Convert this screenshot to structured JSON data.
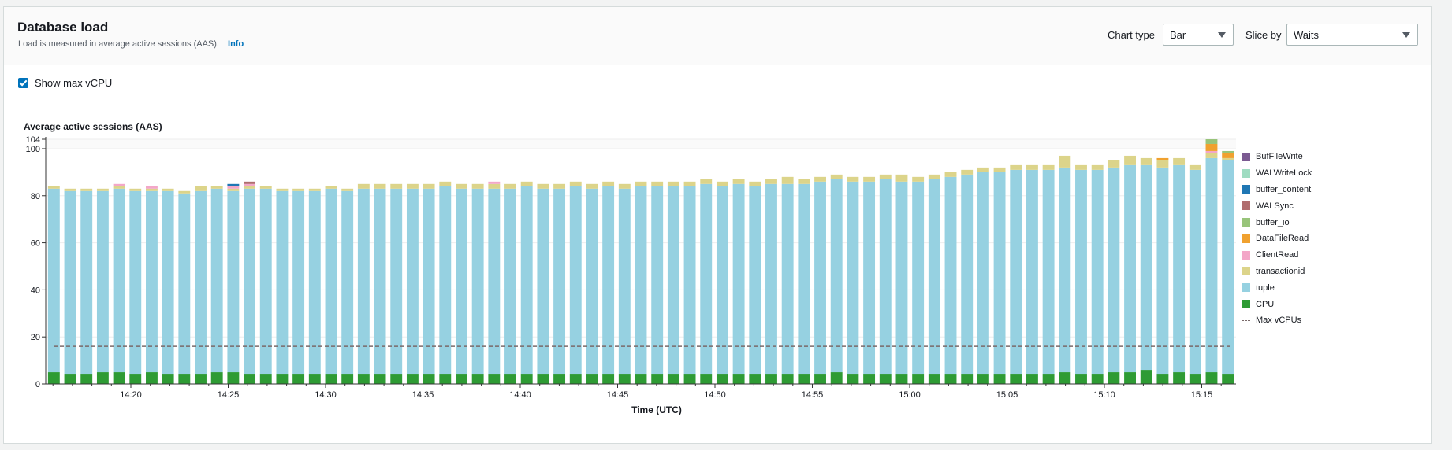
{
  "header": {
    "title": "Database load",
    "subtitle": "Load is measured in average active sessions (AAS).",
    "info_link": "Info",
    "chart_type_label": "Chart type",
    "chart_type_value": "Bar",
    "slice_by_label": "Slice by",
    "slice_by_value": "Waits"
  },
  "options": {
    "show_max_vcpu_label": "Show max vCPU",
    "show_max_vcpu_checked": true
  },
  "chart_data": {
    "type": "bar",
    "stacked": true,
    "title": "Average active sessions (AAS)",
    "xlabel": "Time (UTC)",
    "ylabel": "",
    "ylim": [
      0,
      104
    ],
    "yticks": [
      0,
      20,
      40,
      60,
      80,
      100,
      104
    ],
    "xticks": [
      "14:20",
      "14:25",
      "14:30",
      "14:35",
      "14:40",
      "14:45",
      "14:50",
      "14:55",
      "15:00",
      "15:05",
      "15:10",
      "15:15"
    ],
    "max_vcpus": 16,
    "legend_position": "right",
    "legend": [
      "BufFileWrite",
      "WALWriteLock",
      "buffer_content",
      "WALSync",
      "buffer_io",
      "DataFileRead",
      "ClientRead",
      "transactionid",
      "tuple",
      "CPU",
      "Max vCPUs"
    ],
    "colors": {
      "CPU": "#2e9b34",
      "tuple": "#96d1e1",
      "transactionid": "#dcd48a",
      "ClientRead": "#f3a7c8",
      "DataFileRead": "#f0a12f",
      "buffer_io": "#98c47a",
      "WALSync": "#b06d6e",
      "buffer_content": "#1f77b4",
      "WALWriteLock": "#9fdcc1",
      "BufFileWrite": "#7b5a91",
      "Max vCPUs": "#7a6a6a"
    },
    "series": [
      {
        "name": "CPU",
        "values": [
          5,
          4,
          4,
          5,
          5,
          4,
          5,
          4,
          4,
          4,
          5,
          5,
          4,
          4,
          4,
          4,
          4,
          4,
          4,
          4,
          4,
          4,
          4,
          4,
          4,
          4,
          4,
          4,
          4,
          4,
          4,
          4,
          4,
          4,
          4,
          4,
          4,
          4,
          4,
          4,
          4,
          4,
          4,
          4,
          4,
          4,
          4,
          4,
          5,
          4,
          4,
          4,
          4,
          4,
          4,
          4,
          4,
          4,
          4,
          4,
          4,
          4,
          5,
          4,
          4,
          5,
          5,
          6,
          4,
          5,
          4,
          5,
          4
        ]
      },
      {
        "name": "tuple",
        "values": [
          78,
          78,
          78,
          77,
          78,
          78,
          77,
          78,
          77,
          78,
          78,
          77,
          79,
          79,
          78,
          78,
          78,
          79,
          78,
          79,
          79,
          79,
          79,
          79,
          80,
          79,
          79,
          79,
          79,
          80,
          79,
          79,
          80,
          79,
          80,
          79,
          80,
          80,
          80,
          80,
          81,
          80,
          81,
          80,
          81,
          81,
          81,
          82,
          82,
          82,
          82,
          83,
          82,
          82,
          83,
          84,
          85,
          86,
          86,
          87,
          87,
          87,
          87,
          87,
          87,
          87,
          88,
          87,
          88,
          88,
          87,
          91,
          91
        ]
      },
      {
        "name": "transactionid",
        "values": [
          1,
          1,
          1,
          1,
          1,
          1,
          1,
          1,
          1,
          2,
          1,
          1,
          1,
          1,
          1,
          1,
          1,
          1,
          1,
          2,
          2,
          2,
          2,
          2,
          2,
          2,
          2,
          2,
          2,
          2,
          2,
          2,
          2,
          2,
          2,
          2,
          2,
          2,
          2,
          2,
          2,
          2,
          2,
          2,
          2,
          3,
          2,
          2,
          2,
          2,
          2,
          2,
          3,
          2,
          2,
          2,
          2,
          2,
          2,
          2,
          2,
          2,
          5,
          2,
          2,
          3,
          4,
          3,
          3,
          3,
          2,
          2,
          1
        ]
      },
      {
        "name": "ClientRead",
        "values": [
          0,
          0,
          0,
          0,
          1,
          0,
          1,
          0,
          0,
          0,
          0,
          1,
          1,
          0,
          0,
          0,
          0,
          0,
          0,
          0,
          0,
          0,
          0,
          0,
          0,
          0,
          0,
          1,
          0,
          0,
          0,
          0,
          0,
          0,
          0,
          0,
          0,
          0,
          0,
          0,
          0,
          0,
          0,
          0,
          0,
          0,
          0,
          0,
          0,
          0,
          0,
          0,
          0,
          0,
          0,
          0,
          0,
          0,
          0,
          0,
          0,
          0,
          0,
          0,
          0,
          0,
          0,
          0,
          0,
          0,
          0,
          1,
          0
        ]
      },
      {
        "name": "DataFileRead",
        "values": [
          0,
          0,
          0,
          0,
          0,
          0,
          0,
          0,
          0,
          0,
          0,
          0,
          0,
          0,
          0,
          0,
          0,
          0,
          0,
          0,
          0,
          0,
          0,
          0,
          0,
          0,
          0,
          0,
          0,
          0,
          0,
          0,
          0,
          0,
          0,
          0,
          0,
          0,
          0,
          0,
          0,
          0,
          0,
          0,
          0,
          0,
          0,
          0,
          0,
          0,
          0,
          0,
          0,
          0,
          0,
          0,
          0,
          0,
          0,
          0,
          0,
          0,
          0,
          0,
          0,
          0,
          0,
          0,
          1,
          0,
          0,
          3,
          2
        ]
      },
      {
        "name": "buffer_io",
        "values": [
          0,
          0,
          0,
          0,
          0,
          0,
          0,
          0,
          0,
          0,
          0,
          0,
          0,
          0,
          0,
          0,
          0,
          0,
          0,
          0,
          0,
          0,
          0,
          0,
          0,
          0,
          0,
          0,
          0,
          0,
          0,
          0,
          0,
          0,
          0,
          0,
          0,
          0,
          0,
          0,
          0,
          0,
          0,
          0,
          0,
          0,
          0,
          0,
          0,
          0,
          0,
          0,
          0,
          0,
          0,
          0,
          0,
          0,
          0,
          0,
          0,
          0,
          0,
          0,
          0,
          0,
          0,
          0,
          0,
          0,
          0,
          2,
          1
        ]
      },
      {
        "name": "WALSync",
        "values": [
          0,
          0,
          0,
          0,
          0,
          0,
          0,
          0,
          0,
          0,
          0,
          0,
          1,
          0,
          0,
          0,
          0,
          0,
          0,
          0,
          0,
          0,
          0,
          0,
          0,
          0,
          0,
          0,
          0,
          0,
          0,
          0,
          0,
          0,
          0,
          0,
          0,
          0,
          0,
          0,
          0,
          0,
          0,
          0,
          0,
          0,
          0,
          0,
          0,
          0,
          0,
          0,
          0,
          0,
          0,
          0,
          0,
          0,
          0,
          0,
          0,
          0,
          0,
          0,
          0,
          0,
          0,
          0,
          0,
          0,
          0,
          0,
          0
        ]
      },
      {
        "name": "buffer_content",
        "values": [
          0,
          0,
          0,
          0,
          0,
          0,
          0,
          0,
          0,
          0,
          0,
          1,
          0,
          0,
          0,
          0,
          0,
          0,
          0,
          0,
          0,
          0,
          0,
          0,
          0,
          0,
          0,
          0,
          0,
          0,
          0,
          0,
          0,
          0,
          0,
          0,
          0,
          0,
          0,
          0,
          0,
          0,
          0,
          0,
          0,
          0,
          0,
          0,
          0,
          0,
          0,
          0,
          0,
          0,
          0,
          0,
          0,
          0,
          0,
          0,
          0,
          0,
          0,
          0,
          0,
          0,
          0,
          0,
          0,
          0,
          0,
          0,
          0
        ]
      },
      {
        "name": "WALWriteLock",
        "values": [
          0,
          0,
          0,
          0,
          0,
          0,
          0,
          0,
          0,
          0,
          0,
          0,
          0,
          0,
          0,
          0,
          0,
          0,
          0,
          0,
          0,
          0,
          0,
          0,
          0,
          0,
          0,
          0,
          0,
          0,
          0,
          0,
          0,
          0,
          0,
          0,
          0,
          0,
          0,
          0,
          0,
          0,
          0,
          0,
          0,
          0,
          0,
          0,
          0,
          0,
          0,
          0,
          0,
          0,
          0,
          0,
          0,
          0,
          0,
          0,
          0,
          0,
          0,
          0,
          0,
          0,
          0,
          0,
          0,
          0,
          0,
          0,
          0
        ]
      },
      {
        "name": "BufFileWrite",
        "values": [
          0,
          0,
          0,
          0,
          0,
          0,
          0,
          0,
          0,
          0,
          0,
          0,
          0,
          0,
          0,
          0,
          0,
          0,
          0,
          0,
          0,
          0,
          0,
          0,
          0,
          0,
          0,
          0,
          0,
          0,
          0,
          0,
          0,
          0,
          0,
          0,
          0,
          0,
          0,
          0,
          0,
          0,
          0,
          0,
          0,
          0,
          0,
          0,
          0,
          0,
          0,
          0,
          0,
          0,
          0,
          0,
          0,
          0,
          0,
          0,
          0,
          0,
          0,
          0,
          0,
          0,
          0,
          0,
          0,
          0,
          0,
          0,
          0
        ]
      }
    ]
  }
}
